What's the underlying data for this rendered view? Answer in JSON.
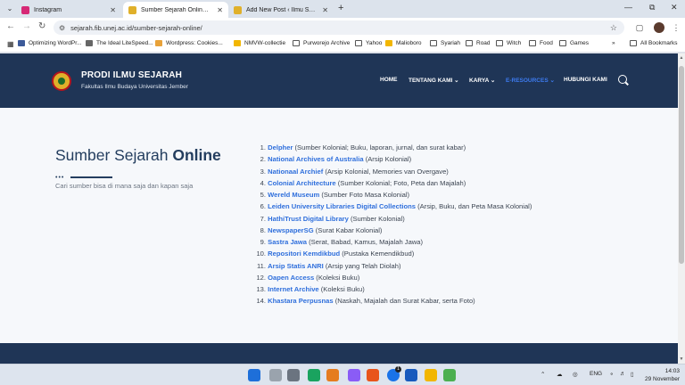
{
  "browser": {
    "tabs": [
      {
        "title": "Instagram",
        "fav_color": "#d62976"
      },
      {
        "title": "Sumber Sejarah Online - Ilmu Sejarah",
        "fav_color": "#e0b02a"
      },
      {
        "title": "Add New Post ‹ Ilmu Sejarah FIB",
        "fav_color": "#e0b02a"
      }
    ],
    "url": "sejarah.fib.unej.ac.id/sumber-sejarah-online/",
    "bookmarks": [
      {
        "label": "Optimizing WordPr...",
        "icon_color": "#3c5a99"
      },
      {
        "label": "The Ideal LiteSpeed...",
        "icon_color": "#666666"
      },
      {
        "label": "Wordpress: Cookies...",
        "icon_color": "#e8a23a"
      },
      {
        "label": "NMVW-collectie",
        "icon_color": "#f2b600"
      },
      {
        "label": "Purworejo Archive",
        "icon_color": "folder"
      },
      {
        "label": "Yahoo",
        "icon_color": "folder"
      },
      {
        "label": "Malioboro",
        "icon_color": "#f2b600"
      },
      {
        "label": "Syariah",
        "icon_color": "folder"
      },
      {
        "label": "Road",
        "icon_color": "folder"
      },
      {
        "label": "Witch",
        "icon_color": "folder"
      },
      {
        "label": "Food",
        "icon_color": "folder"
      },
      {
        "label": "Games",
        "icon_color": "folder"
      }
    ],
    "all_bookmarks": "All Bookmarks",
    "more_bookmarks": "»"
  },
  "site": {
    "brand": "PRODI ILMU SEJARAH",
    "brand_sub": "Fakultas Ilmu Budaya Universitas Jember",
    "menu": [
      {
        "label": "HOME"
      },
      {
        "label": "TENTANG KAMI ⌄"
      },
      {
        "label": "KARYA ⌄"
      },
      {
        "label": "E-RESOURCES ⌄",
        "current": true
      },
      {
        "label": "HUBUNGI KAMI"
      }
    ]
  },
  "main": {
    "title_plain": "Sumber Sejarah ",
    "title_bold": "Online",
    "subtitle": "Cari sumber bisa di mana saja dan kapan saja",
    "sources": [
      {
        "n": "1.",
        "name": "Delpher",
        "desc": " (Sumber Kolonial; Buku, laporan, jurnal, dan surat kabar)"
      },
      {
        "n": "2.",
        "name": "National Archives of Australia",
        "desc": " (Arsip Kolonial)"
      },
      {
        "n": "3.",
        "name": "Nationaal Archief",
        "desc": " (Arsip Kolonial, Memories van Overgave)"
      },
      {
        "n": "4.",
        "name": "Colonial Architecture",
        "desc": " (Sumber Kolonial; Foto, Peta dan Majalah)"
      },
      {
        "n": "5.",
        "name": "Wereld Museum",
        "desc": " (Sumber Foto Masa Kolonial)"
      },
      {
        "n": "6.",
        "name": "Leiden University Libraries Digital Collections",
        "desc": " (Arsip, Buku, dan Peta Masa Kolonial)"
      },
      {
        "n": "7.",
        "name": "HathiTrust Digital Library",
        "desc": " (Sumber Kolonial)"
      },
      {
        "n": "8.",
        "name": "NewspaperSG",
        "desc": " (Surat Kabar Kolonial)"
      },
      {
        "n": "9.",
        "name": "Sastra Jawa",
        "desc": " (Serat, Babad, Kamus, Majalah Jawa)"
      },
      {
        "n": "10.",
        "name": "Repositori Kemdikbud",
        "desc": " (Pustaka Kemendikbud)"
      },
      {
        "n": "11.",
        "name": "Arsip Statis ANRI",
        "desc": " (Arsip yang Telah Diolah)"
      },
      {
        "n": "12.",
        "name": "Oapen Access",
        "desc": " (Koleksi Buku)"
      },
      {
        "n": "13.",
        "name": "Internet Archive",
        "desc": " (Koleksi Buku)"
      },
      {
        "n": "14.",
        "name": "Khastara Perpusnas",
        "desc": " (Naskah, Majalah dan Surat Kabar, serta Foto)"
      }
    ]
  },
  "taskbar": {
    "apps": [
      {
        "name": "windows-start-icon",
        "color": "#1e6fd9"
      },
      {
        "name": "search-taskbar-icon",
        "color": "#9aa3ad"
      },
      {
        "name": "task-view-icon",
        "color": "#6b7480"
      },
      {
        "name": "edge-icon",
        "color": "#1aa35f"
      },
      {
        "name": "search-app-icon",
        "color": "#e57c1f"
      },
      {
        "name": "copilot-icon",
        "color": "#8a5cf6"
      },
      {
        "name": "firefox-icon",
        "color": "#e8541b"
      },
      {
        "name": "chrome-icon",
        "color": "#1a73e8"
      },
      {
        "name": "word-icon",
        "color": "#185abd"
      },
      {
        "name": "file-explorer-icon",
        "color": "#f2b600"
      },
      {
        "name": "app-icon",
        "color": "#4caf50"
      }
    ],
    "chrome_badge": "1",
    "language": "ENG",
    "time": "14:03",
    "date": "29 November"
  }
}
